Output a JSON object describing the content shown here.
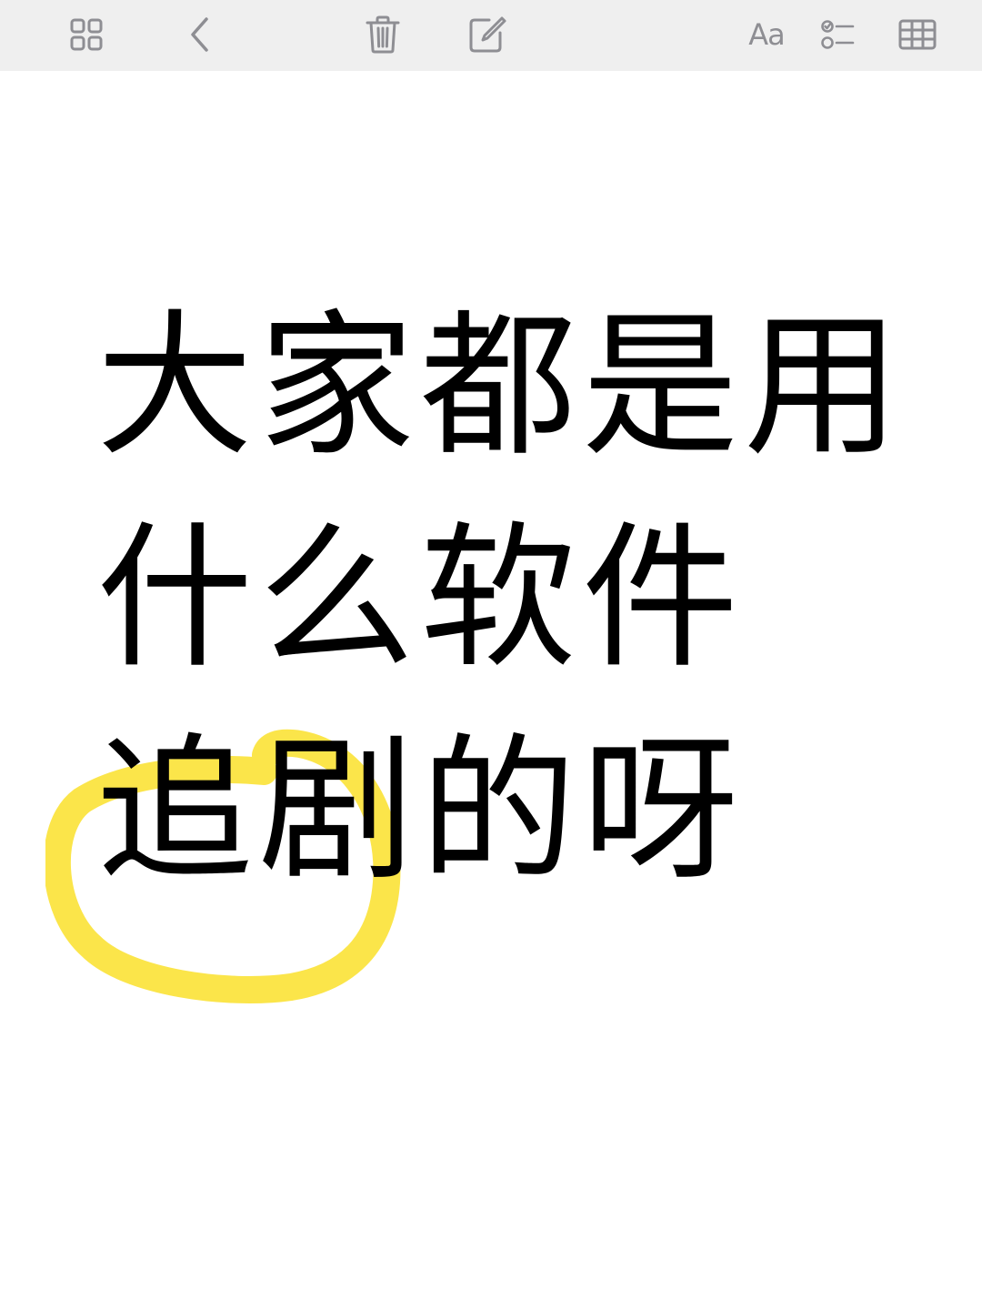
{
  "toolbar": {
    "icons": {
      "gallery": "grid-icon",
      "back": "chevron-left-icon",
      "delete": "trash-icon",
      "compose": "compose-icon",
      "format": "text-format-icon",
      "checklist": "checklist-icon",
      "table": "table-icon"
    },
    "format_label": "Aa",
    "icon_color": "#8e8e93",
    "background": "#efefef"
  },
  "note": {
    "lines": [
      "大家都是用",
      "什么软件",
      "追剧的呀"
    ],
    "text_color": "#000000",
    "highlight_color": "#fbe54a",
    "highlight_target": "追剧"
  }
}
